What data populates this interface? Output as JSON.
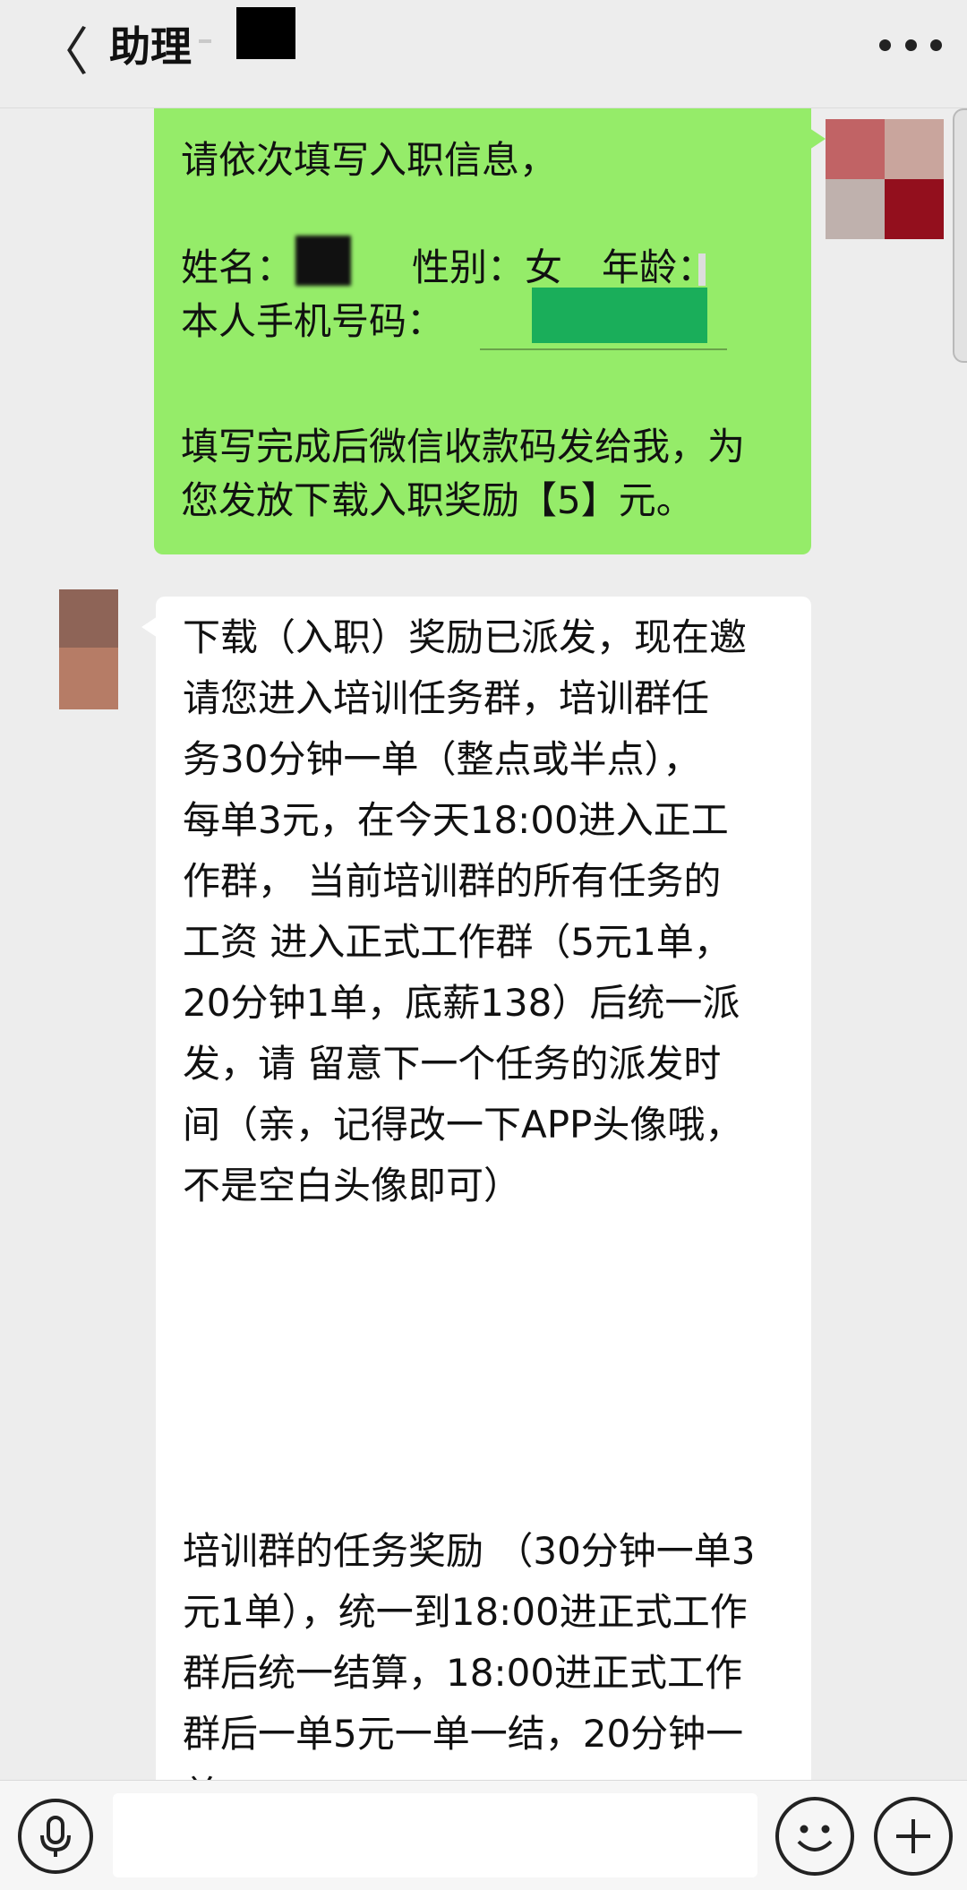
{
  "header": {
    "back_icon": "chevron-left-icon",
    "back_glyph": "〈",
    "title": "助理",
    "more_icon": "more-dots-icon"
  },
  "messages": {
    "outgoing": {
      "lines": [
        "请依次填写入职信息，",
        "姓名：",
        "性别：女",
        "年龄：",
        "本人手机号码：",
        "填写完成后微信收款码发给我，为",
        "您发放下载入职奖励【5】元。"
      ]
    },
    "incoming": {
      "lines": [
        "下载（入职）奖励已派发，现在邀",
        "请您进入培训任务群，培训群任",
        "务30分钟一单（整点或半点），",
        "每单3元，在今天18:00进入正工",
        "作群， 当前培训群的所有任务的",
        "工资 进入正式工作群（5元1单，",
        "20分钟1单，底薪138）后统一派",
        "发，请 留意下一个任务的派发时",
        "间（亲，记得改一下APP头像哦，",
        "不是空白头像即可）",
        "培训群的任务奖励 （30分钟一单3",
        "元1单），统一到18:00进正式工作",
        "群后统一结算，18:00进正式工作",
        "群后一单5元一单一结，20分钟一",
        "单"
      ]
    }
  },
  "footer": {
    "voice_icon": "microphone-icon",
    "emoji_icon": "smiley-icon",
    "plus_icon": "plus-icon",
    "input_value": ""
  },
  "colors": {
    "outgoing_bubble": "#95ec69",
    "incoming_bubble": "#ffffff",
    "background": "#ededed"
  }
}
